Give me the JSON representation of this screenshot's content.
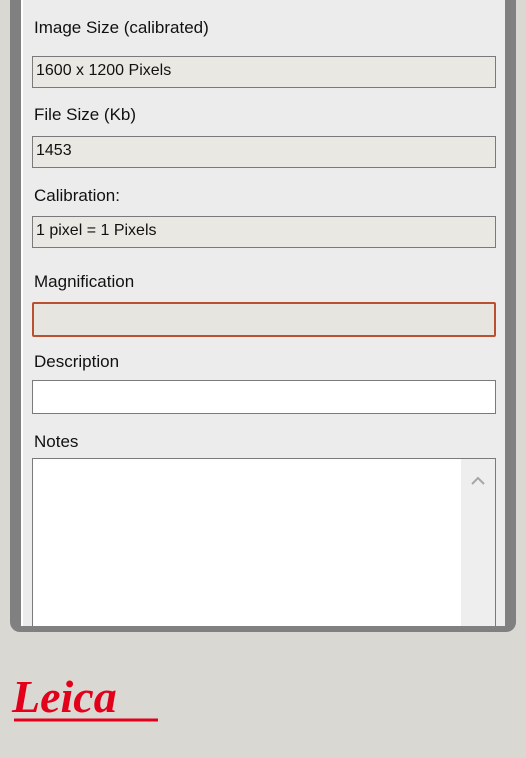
{
  "fields": {
    "image_size": {
      "label": "Image Size (calibrated)",
      "value": "1600 x 1200 Pixels"
    },
    "file_size": {
      "label": "File Size (Kb)",
      "value": "1453"
    },
    "calibration": {
      "label": "Calibration:",
      "value": "1 pixel = 1 Pixels"
    },
    "magnification": {
      "label": "Magnification",
      "value": ""
    },
    "description": {
      "label": "Description",
      "value": ""
    },
    "notes": {
      "label": "Notes",
      "value": ""
    }
  },
  "logo": {
    "text": "Leica",
    "color": "#e2001a"
  },
  "colors": {
    "focus_border": "#b9502f",
    "panel_bg": "#ececec",
    "window_bg": "#d9d8d2"
  },
  "icons": {
    "scroll_up": "chevron-up-icon"
  }
}
